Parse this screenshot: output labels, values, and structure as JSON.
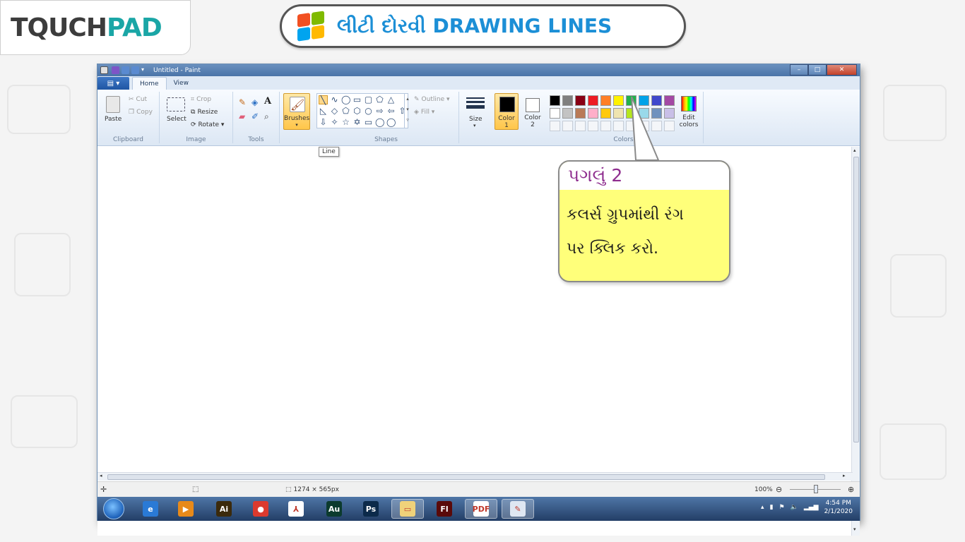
{
  "brand": {
    "logo_part1": "TQUCH",
    "logo_part2": "PAD"
  },
  "header": {
    "title": "લીટી દોરવી  DRAWING LINES"
  },
  "window": {
    "title": "Untitled - Paint",
    "min": "–",
    "max": "□",
    "close": "✕"
  },
  "tabs": [
    {
      "label": "Home"
    },
    {
      "label": "View"
    }
  ],
  "file_menu": "▤ ▾",
  "help": "?",
  "ribbon": {
    "clipboard": {
      "paste": "Paste",
      "cut": "Cut",
      "copy": "Copy",
      "label": "Clipboard"
    },
    "image": {
      "select": "Select",
      "crop": "Crop",
      "resize": "Resize",
      "rotate": "Rotate ▾",
      "label": "Image"
    },
    "tools": {
      "label": "Tools",
      "text_tool": "A"
    },
    "brushes": {
      "label": "Brushes"
    },
    "shapes": {
      "outline": "Outline ▾",
      "fill": "Fill ▾",
      "label": "Shapes"
    },
    "size": {
      "label": "Size"
    },
    "color1": {
      "label": "Color",
      "num": "1"
    },
    "color2": {
      "label": "Color",
      "num": "2"
    },
    "edit_colors": {
      "label1": "Edit",
      "label2": "colors"
    },
    "colors_label": "Colors",
    "palette_row1": [
      "#000000",
      "#7f7f7f",
      "#880015",
      "#ed1c24",
      "#ff7f27",
      "#fff200",
      "#22b14c",
      "#00a2e8",
      "#3f48cc",
      "#a349a4"
    ],
    "palette_row2": [
      "#ffffff",
      "#c3c3c3",
      "#b97a57",
      "#ffaec9",
      "#ffc90e",
      "#efe4b0",
      "#b5e61d",
      "#99d9ea",
      "#7092be",
      "#c8bfe7"
    ]
  },
  "tooltip": "Line",
  "statusbar": {
    "dimensions": "1274 × 565px",
    "zoom": "100%"
  },
  "taskbar": {
    "time": "4:54 PM",
    "date": "2/1/2020",
    "apps": [
      {
        "name": "ie",
        "label": "e",
        "color": "#2a7ad6"
      },
      {
        "name": "media",
        "label": "▶",
        "color": "#e88a1a"
      },
      {
        "name": "illustrator",
        "label": "Ai",
        "color": "#3b2a0c"
      },
      {
        "name": "chrome",
        "label": "●",
        "color": "#db3a2e"
      },
      {
        "name": "acrobat",
        "label": "⅄",
        "color": "#ffffff"
      },
      {
        "name": "audition",
        "label": "Au",
        "color": "#0c3b2e"
      },
      {
        "name": "photoshop",
        "label": "Ps",
        "color": "#0c2a4a"
      },
      {
        "name": "explorer",
        "label": "▭",
        "color": "#f0d27a"
      },
      {
        "name": "flash",
        "label": "Fl",
        "color": "#5a0a0a"
      },
      {
        "name": "pdf",
        "label": "PDF",
        "color": "#ffffff"
      },
      {
        "name": "paint",
        "label": "✎",
        "color": "#dfe7f2"
      }
    ]
  },
  "callout": {
    "step": "પગલું 2",
    "line1": "કલર્સ ગ્રુપમાંથી રંગ",
    "line2": "પર ક્લિક કરો."
  }
}
